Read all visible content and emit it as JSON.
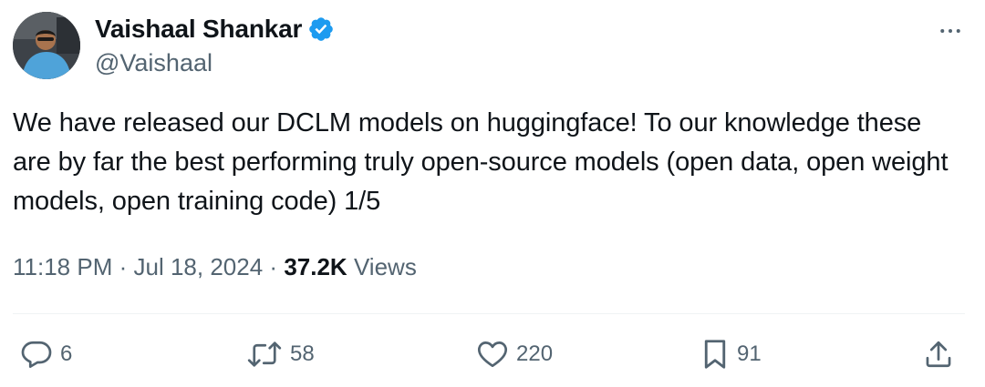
{
  "author": {
    "display_name": "Vaishaal Shankar",
    "handle": "@Vaishaal",
    "verified": true
  },
  "tweet": {
    "text": "We have released our DCLM models on huggingface! To our knowledge these are by far the best performing truly open-source models (open data, open weight models, open training code) 1/5",
    "time": "11:18 PM",
    "separator": "·",
    "date": "Jul 18, 2024",
    "views_count": "37.2K",
    "views_label": "Views"
  },
  "actions": {
    "replies": "6",
    "retweets": "58",
    "likes": "220",
    "bookmarks": "91"
  },
  "icons": {
    "more": "more-horizontal-icon",
    "reply": "reply-icon",
    "retweet": "retweet-icon",
    "like": "heart-icon",
    "bookmark": "bookmark-icon",
    "share": "share-icon",
    "verified": "verified-badge-icon"
  },
  "colors": {
    "verified_blue": "#1d9bf0",
    "text_primary": "#0f1419",
    "text_secondary": "#536471",
    "divider": "#eff3f4"
  }
}
